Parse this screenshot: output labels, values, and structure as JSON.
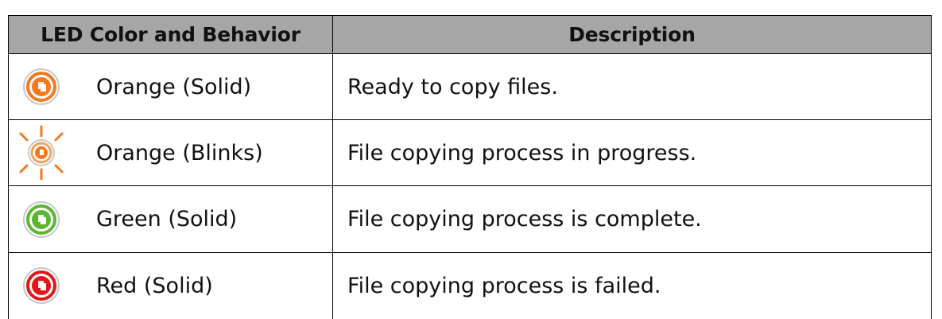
{
  "table": {
    "headers": {
      "behavior": "LED Color and Behavior",
      "description": "Description"
    },
    "rows": [
      {
        "label": "Orange (Solid)",
        "description": "Ready to copy files.",
        "color": "#f47920",
        "icon": "orange-solid-led-icon"
      },
      {
        "label": "Orange (Blinks)",
        "description": "File copying process in progress.",
        "color": "#f47920",
        "icon": "orange-blinking-led-icon"
      },
      {
        "label": "Green (Solid)",
        "description": "File copying process is complete.",
        "color": "#5cb531",
        "icon": "green-solid-led-icon"
      },
      {
        "label": "Red (Solid)",
        "description": "File copying process is failed.",
        "color": "#e3171b",
        "icon": "red-solid-led-icon"
      }
    ],
    "header_bg": "#a6a6a6"
  }
}
